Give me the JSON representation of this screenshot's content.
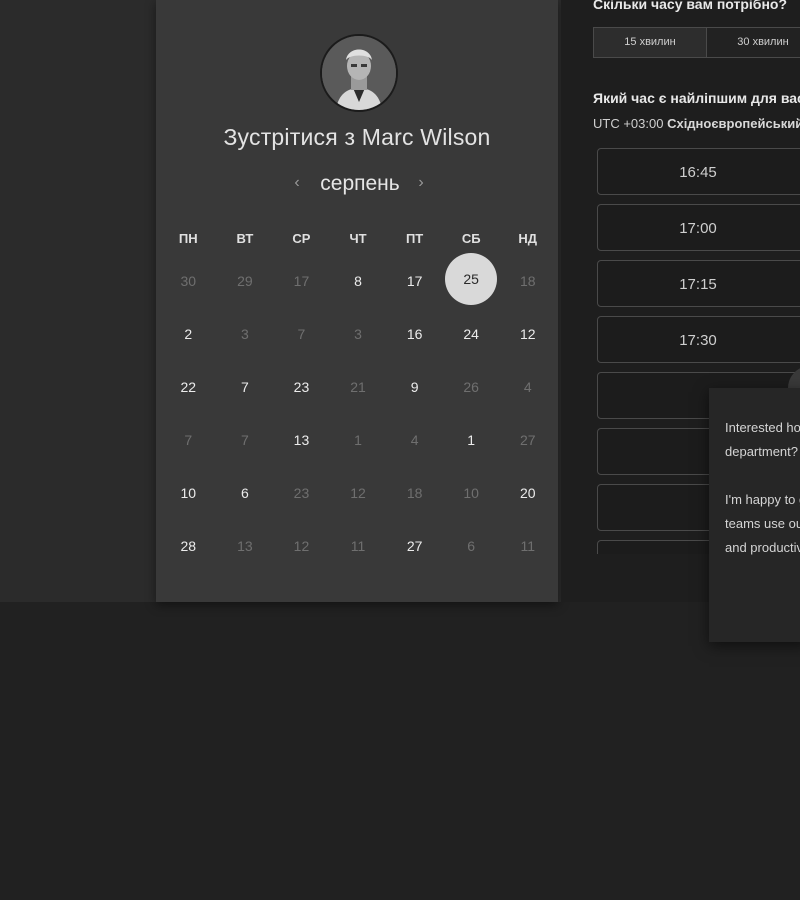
{
  "host": {
    "title": "Зустрітися з Marc Wilson"
  },
  "calendar": {
    "month": "серпень",
    "weekdays": [
      "ПН",
      "ВТ",
      "СР",
      "ЧТ",
      "ПТ",
      "СБ",
      "НД"
    ],
    "weeks": [
      [
        "30",
        "29",
        "17",
        "8",
        "17",
        "25",
        "18"
      ],
      [
        "2",
        "3",
        "7",
        "3",
        "16",
        "24",
        "12"
      ],
      [
        "22",
        "7",
        "23",
        "21",
        "9",
        "26",
        "4"
      ],
      [
        "7",
        "7",
        "13",
        "1",
        "4",
        "1",
        "27"
      ],
      [
        "10",
        "6",
        "23",
        "12",
        "18",
        "10",
        "20"
      ],
      [
        "28",
        "13",
        "12",
        "11",
        "27",
        "6",
        "11"
      ]
    ]
  },
  "booking": {
    "duration_question": "Скільки часу вам потрібно?",
    "durations": [
      "15 хвилин",
      "30 хвилин"
    ],
    "time_question": "Який час є найліпшим для вас?",
    "timezone_prefix": "UTC +03:00",
    "timezone_name": "Східноєвропейський час",
    "slots": [
      "16:45",
      "17:00",
      "17:15",
      "17:30",
      "",
      "",
      ""
    ]
  },
  "chat": {
    "paragraph1": "Interested how your Management department?",
    "paragraph2": "I'm happy to give you insight into how teams use our platform for improvement and productivity."
  }
}
